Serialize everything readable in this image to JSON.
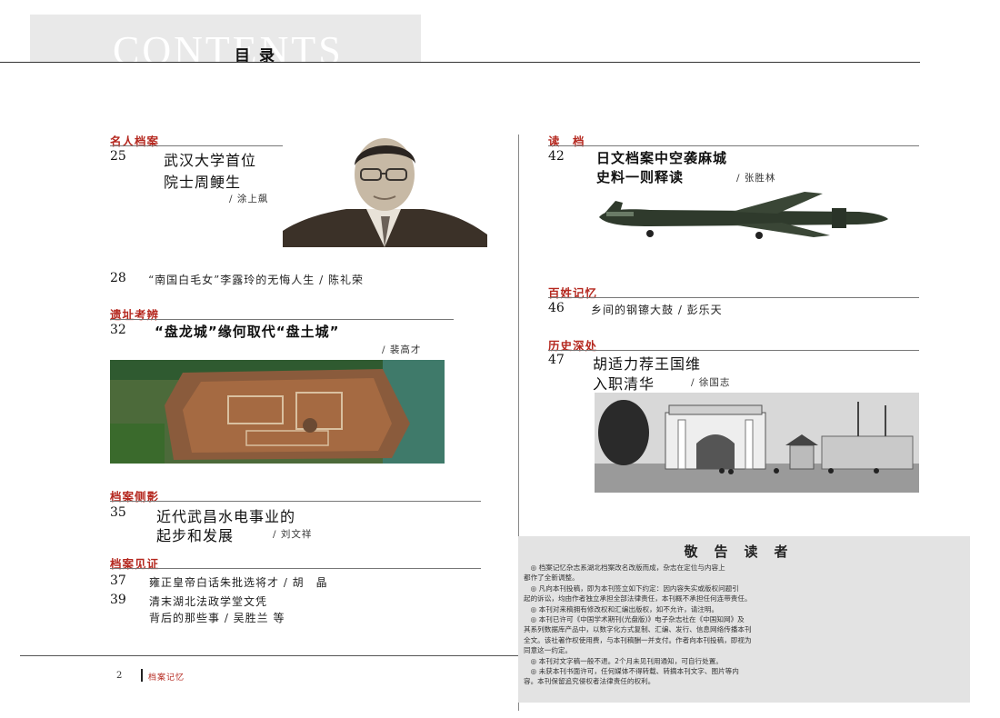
{
  "header": {
    "contents_word": "CONTENTS",
    "title": "目录"
  },
  "left": {
    "s1": {
      "label": "名人档案",
      "num": "25",
      "title_l1": "武汉大学首位",
      "title_l2": "院士周鲠生",
      "author": "/ 涂上飙"
    },
    "s1b": {
      "num": "28",
      "text": "“南国白毛女”李露玲的无悔人生 / 陈礼荣"
    },
    "s2": {
      "label": "遗址考辨",
      "num": "32",
      "title": "“盘龙城”缘何取代“盘土城”",
      "author": "/ 裴高才"
    },
    "s3": {
      "label": "档案侧影",
      "num": "35",
      "title_l1": "近代武昌水电事业的",
      "title_l2": "起步和发展",
      "author": "/ 刘文祥"
    },
    "s4": {
      "label": "档案见证",
      "num1": "37",
      "text1": "雍正皇帝白话朱批选将才 / 胡　晶",
      "num2": "39",
      "text2_l1": "清末湖北法政学堂文凭",
      "text2_l2": "背后的那些事 / 吴胜兰 等"
    }
  },
  "right": {
    "r1": {
      "label": "读　档",
      "num": "42",
      "title_l1": "日文档案中空袭麻城",
      "title_l2": "史料一则释读",
      "author": "/ 张胜林"
    },
    "r2": {
      "label": "百姓记忆",
      "num": "46",
      "text": "乡间的钢镲大鼓 / 彭乐天"
    },
    "r3": {
      "label": "历史深处",
      "num": "47",
      "title_l1": "胡适力荐王国维",
      "title_l2": "入职清华",
      "author": "/ 徐国志"
    }
  },
  "notice": {
    "title": "敬告读者",
    "lines": [
      "　◎ 档案记忆杂志系湖北档案改名改版而成，杂志在定位与内容上",
      "都作了全新调整。",
      "　◎ 凡向本刊投稿，即为本刊签立如下约定：因内容失实或版权问题引",
      "起的诉讼，均由作者独立承担全部法律责任，本刊概不承担任何连带责任。",
      "　◎ 本刊对来稿拥有修改权和汇编出版权，如不允许，请注明。",
      "　◎ 本刊已许可《中国学术期刊(光盘版)》电子杂志社在《中国知网》及",
      "其系列数据库产品中，以数字化方式复制、汇编、发行、信息网络传播本刊",
      "全文。该社著作权使用费，与本刊稿酬一并支付。作者向本刊投稿，即视为",
      "同意这一约定。",
      "　◎ 本刊对文字稿一般不退。2个月未见刊用通知，可自行处置。",
      "　◎ 未获本刊书面许可，任何媒体不得转载、转摘本刊文字、图片等内",
      "容。本刊保留追究侵权者法律责任的权利。"
    ]
  },
  "footer": {
    "page": "2",
    "name": "档案记忆"
  }
}
